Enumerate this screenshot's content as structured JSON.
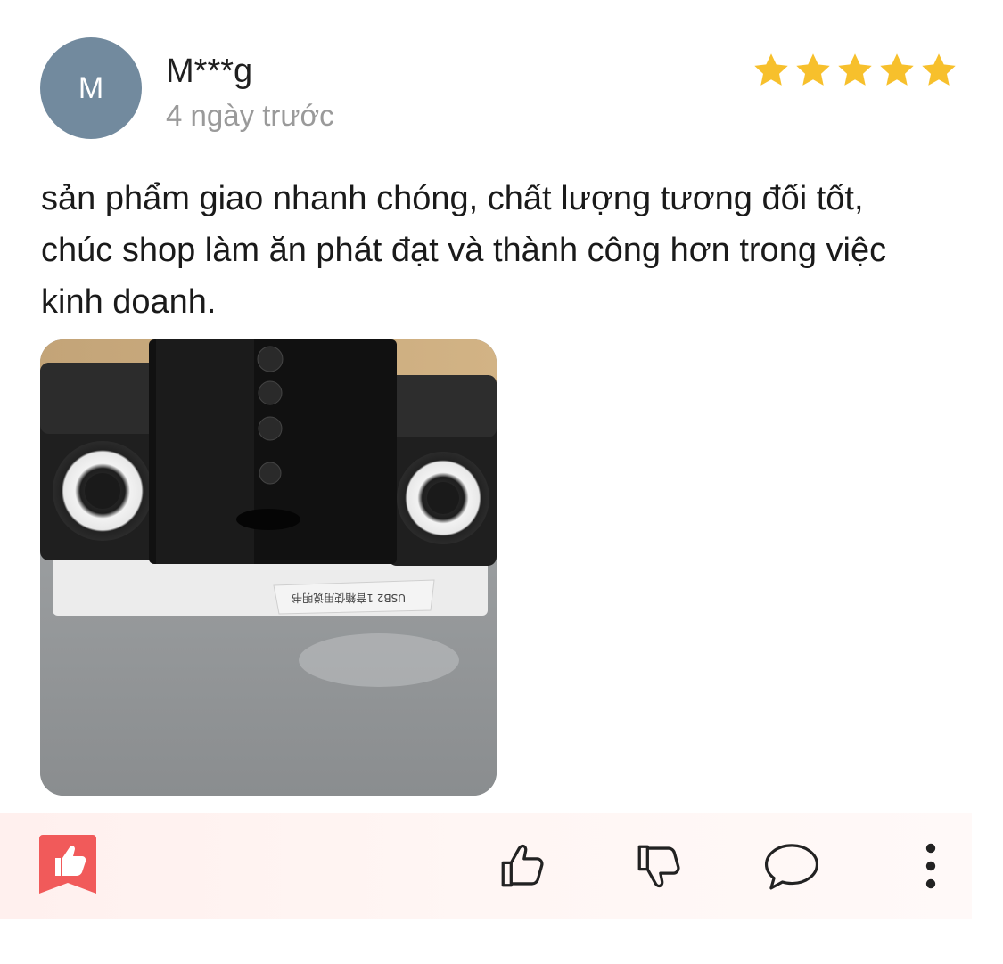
{
  "review": {
    "avatar_initial": "M",
    "user_name": "M***g",
    "time_ago": "4 ngày trước",
    "rating": 5,
    "rating_max": 5,
    "star_color": "#f7c02c",
    "text": "sản phẩm giao nhanh chóng, chất lượng tương đối tốt, chúc shop làm ăn phát đạt và thành công hơn trong việc kinh doanh.",
    "photo_label": "USB2 1音箱使用说明书"
  },
  "actions": {
    "badge_icon": "thumbs-up-badge-icon",
    "like_icon": "thumbs-up-icon",
    "dislike_icon": "thumbs-down-icon",
    "comment_icon": "comment-bubble-icon",
    "more_icon": "more-vertical-icon",
    "badge_color": "#f15a5a"
  }
}
